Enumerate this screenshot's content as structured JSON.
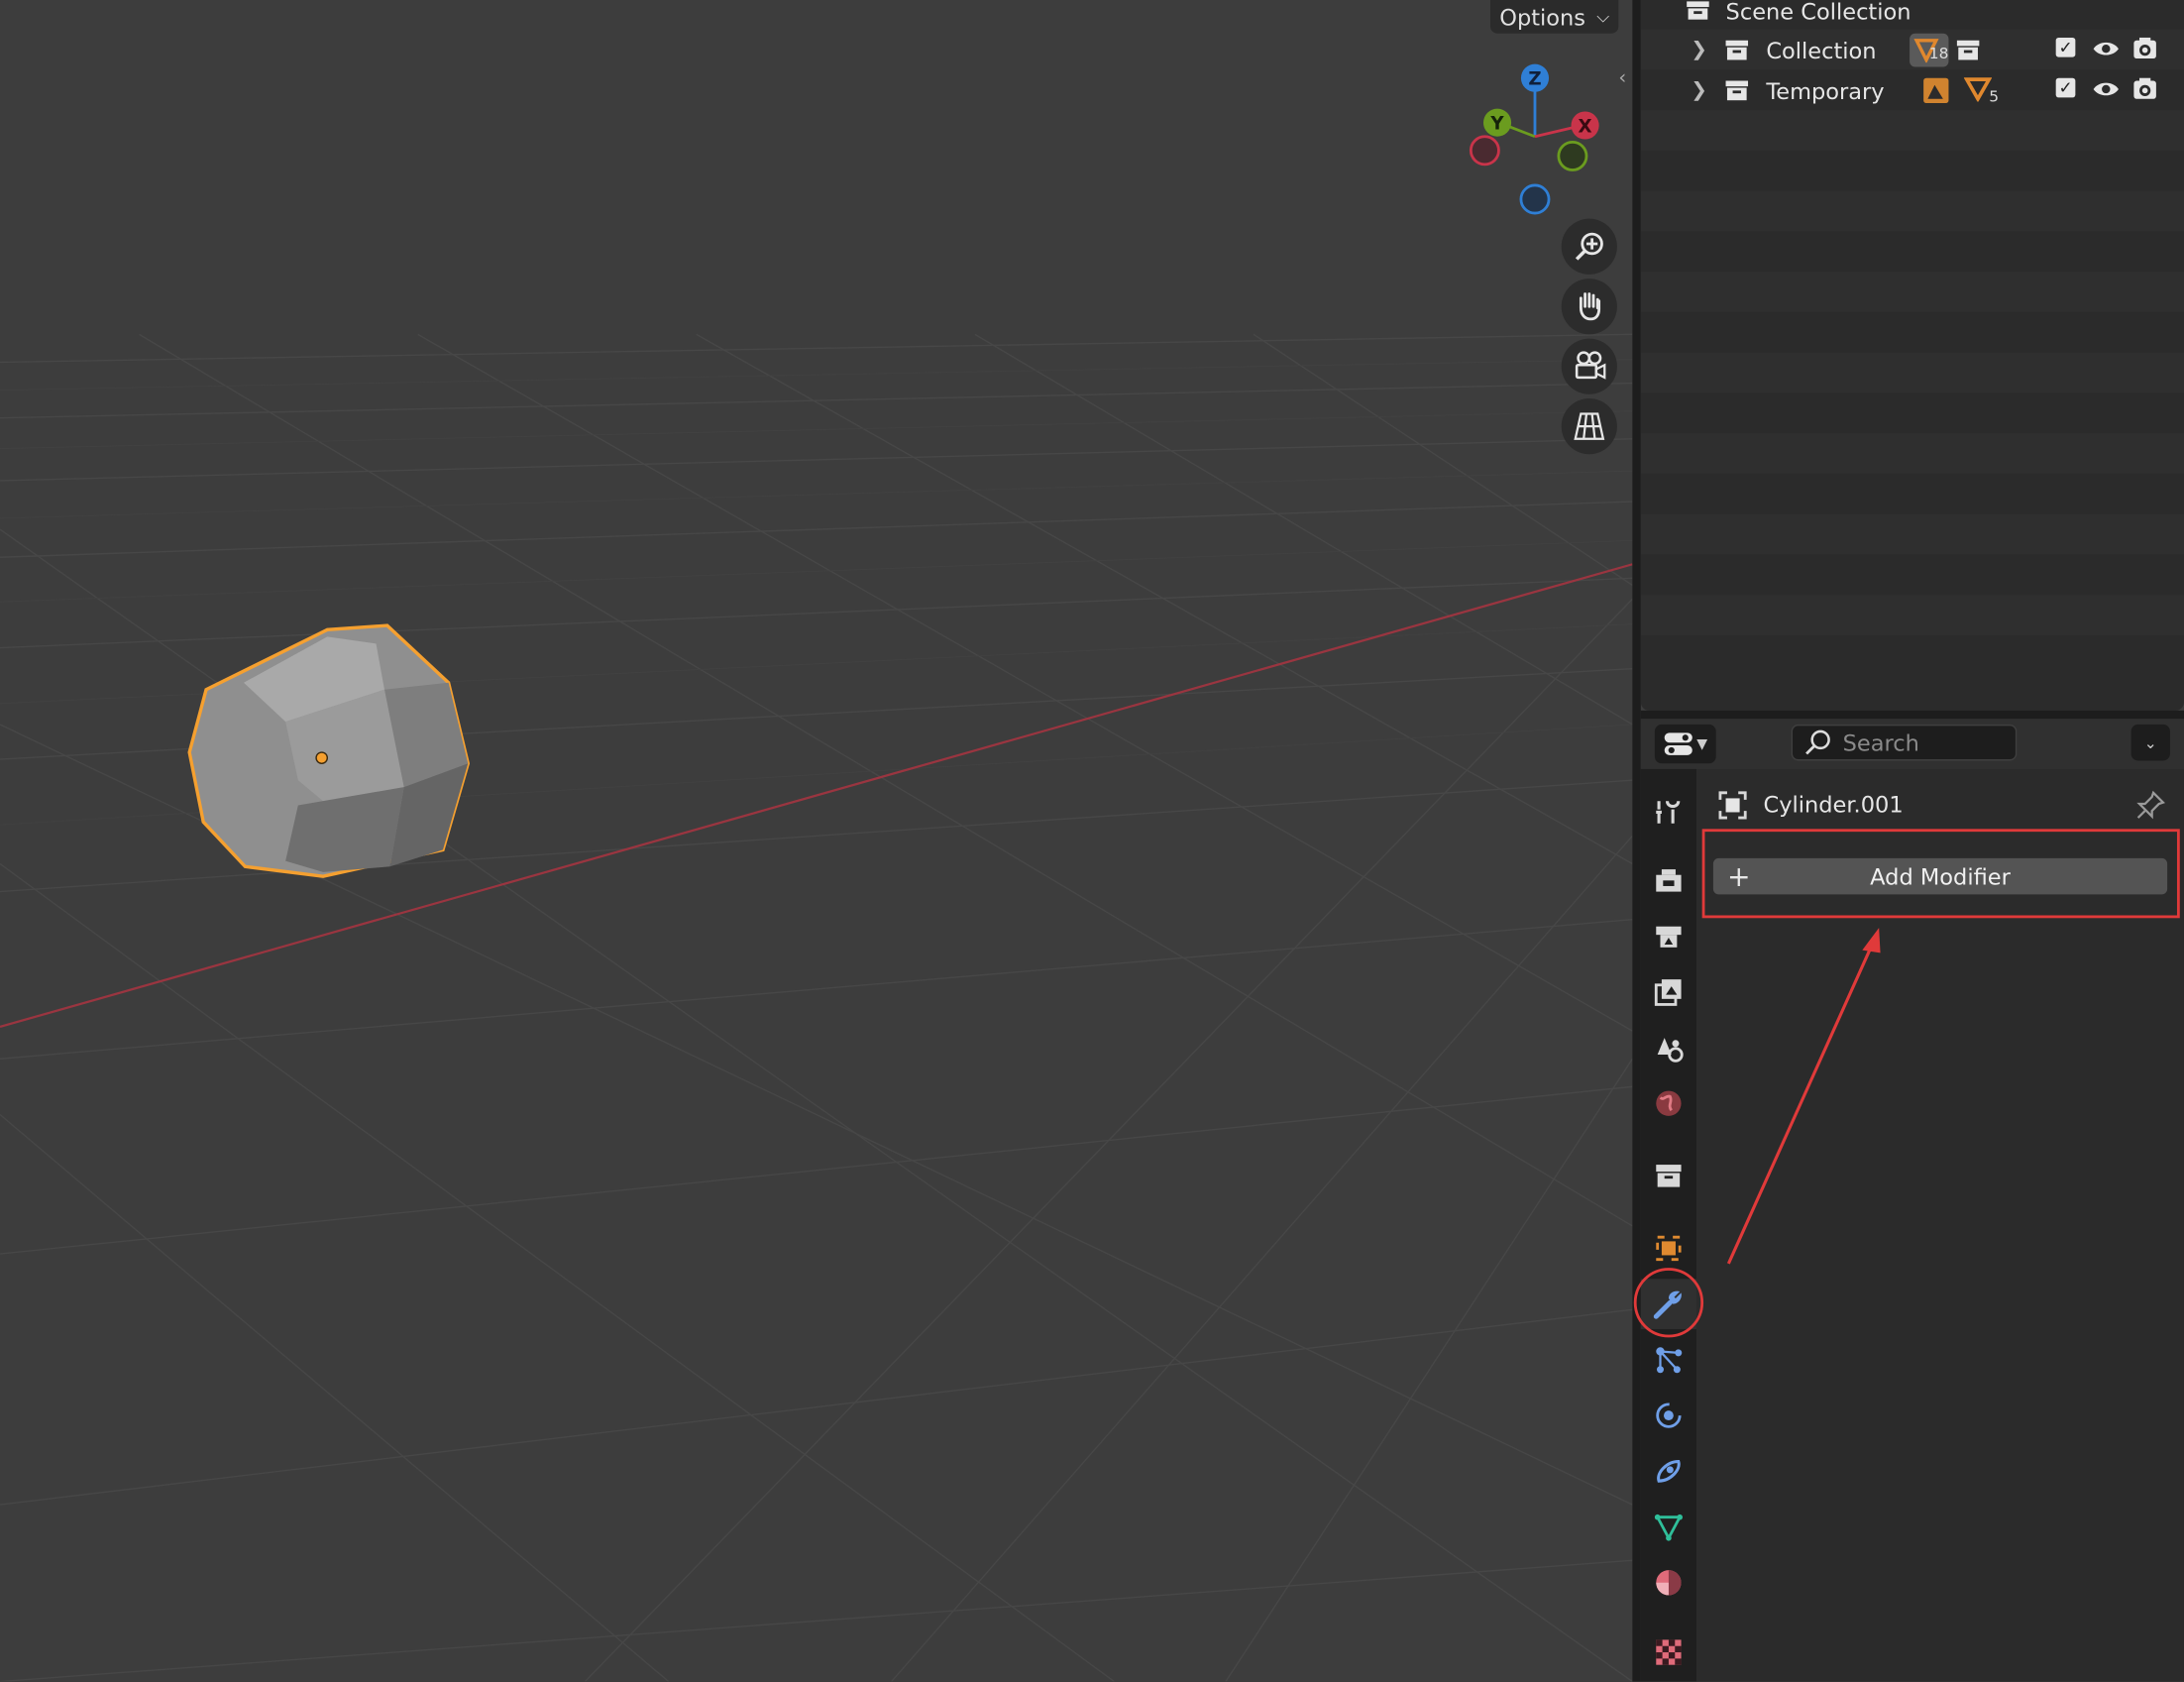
{
  "viewport": {
    "options_label": "Options",
    "gizmo": {
      "z": "Z",
      "y": "Y",
      "x": "X"
    }
  },
  "outliner": {
    "root_label": "Scene Collection",
    "rows": [
      {
        "label": "Collection",
        "badge_count": "18"
      },
      {
        "label": "Temporary",
        "badge_count": "5"
      }
    ]
  },
  "properties": {
    "search_placeholder": "Search",
    "object_name": "Cylinder.001",
    "add_modifier_label": "Add Modifier",
    "add_modifier_plus": "+",
    "tabs": [
      "tool-tab",
      "render-tab",
      "output-tab",
      "view-layer-tab",
      "scene-tab",
      "world-tab",
      "collection-tab",
      "object-tab",
      "modifier-tab",
      "particles-tab",
      "physics-tab",
      "constraints-tab",
      "data-tab",
      "material-tab",
      "texture-tab"
    ],
    "active_tab": "modifier-tab"
  },
  "colors": {
    "selection_outline": "#f5a030",
    "annotation": "#e03a3a",
    "x_axis": "#c9344a",
    "y_axis": "#6b9c1f",
    "z_axis": "#2f7fd6"
  }
}
